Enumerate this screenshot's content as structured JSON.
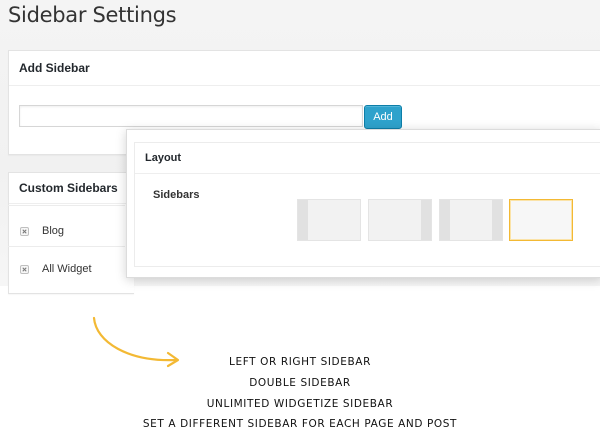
{
  "page": {
    "title": "Sidebar Settings"
  },
  "add_sidebar": {
    "header": "Add Sidebar",
    "input_value": "",
    "input_placeholder": "",
    "add_label": "Add"
  },
  "custom_sidebars": {
    "header": "Custom Sidebars",
    "items": [
      {
        "label": "Blog",
        "icon": "remove-icon"
      },
      {
        "label": "All Widget",
        "icon": "remove-icon"
      }
    ]
  },
  "layout": {
    "header": "Layout",
    "sidebars_label": "Sidebars",
    "options": [
      "left-sidebar",
      "right-sidebar",
      "double-sidebar",
      "no-sidebar"
    ],
    "selected": "no-sidebar",
    "selected_color": "#f3b934"
  },
  "annotation": {
    "arrow_color": "#f3b934",
    "lines": [
      "Left or right sidebar",
      "Double sidebar",
      "Unlimited widgetize sidebar",
      "Set a different sidebar for each page and post"
    ]
  },
  "colors": {
    "button": "#2ea2cc",
    "accent": "#f3b934"
  }
}
